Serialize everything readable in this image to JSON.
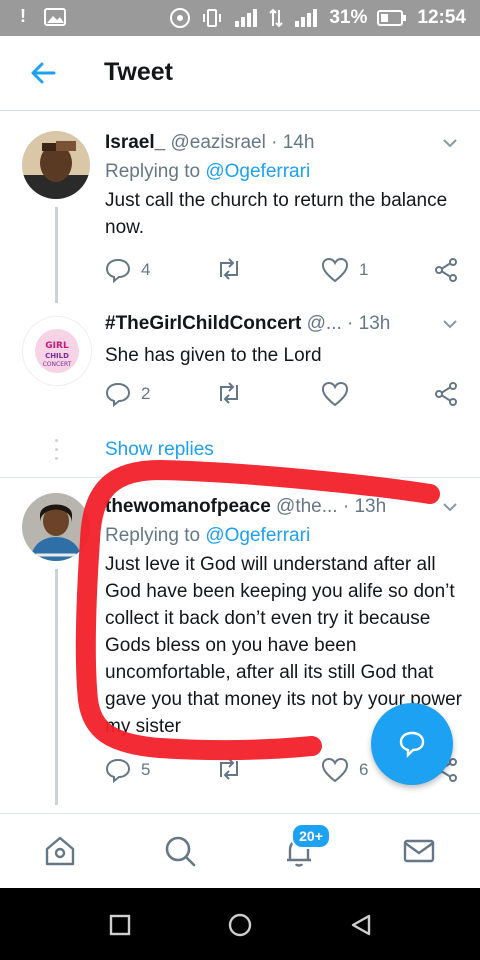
{
  "status_bar": {
    "battery": "31%",
    "time": "12:54"
  },
  "header": {
    "title": "Tweet"
  },
  "tweets": [
    {
      "name": "Israel_",
      "handle": "@eazisrael",
      "time": "· 14h",
      "replying_prefix": "Replying to",
      "replying_to": "@Ogeferrari",
      "text": "Just call the church to return the balance now.",
      "replies": "4",
      "retweets": "",
      "likes": "1"
    },
    {
      "name": "#TheGirlChildConcert",
      "handle": "@...",
      "time": "· 13h",
      "text": "She has given to the Lord",
      "replies": "2",
      "retweets": "",
      "likes": "",
      "avatar_text": "GIRL CHILD CONCERT"
    },
    {
      "name": "thewomanofpeace",
      "handle": "@the...",
      "time": "· 13h",
      "replying_prefix": "Replying to",
      "replying_to": "@Ogeferrari",
      "text": "Just leve it God will understand after all God have been keeping you alife so don’t collect it back don’t even try it because Gods bless on you have been uncomfortable, after all its still God that gave you that money its not by your power my sister",
      "replies": "5",
      "retweets": "",
      "likes": "6"
    }
  ],
  "show_replies": "Show replies",
  "bottom_nav": {
    "notifications_badge": "20+"
  },
  "colors": {
    "accent": "#1da1f2",
    "muted": "#657786",
    "scribble": "#f2202a"
  }
}
